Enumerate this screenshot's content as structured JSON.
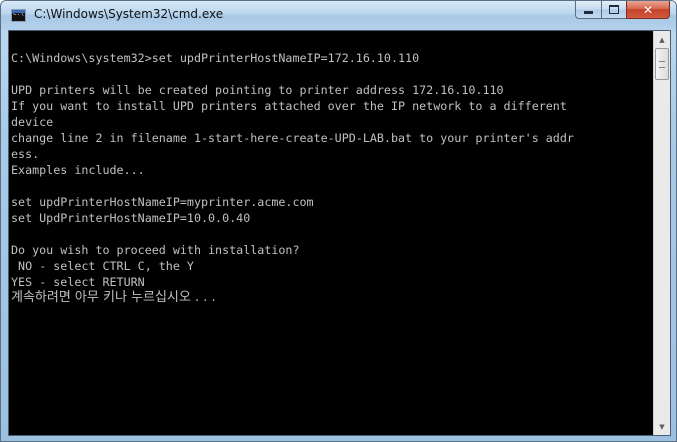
{
  "window": {
    "title": "C:\\Windows\\System32\\cmd.exe",
    "icon": "cmd-app-icon",
    "buttons": {
      "minimize": "minimize-icon",
      "maximize": "maximize-icon",
      "close": "close-icon"
    }
  },
  "console": {
    "lines": [
      "",
      "C:\\Windows\\system32>set updPrinterHostNameIP=172.16.10.110",
      "",
      "UPD printers will be created pointing to printer address 172.16.10.110",
      "If you want to install UPD printers attached over the IP network to a different",
      "device",
      "change line 2 in filename 1-start-here-create-UPD-LAB.bat to your printer's addr",
      "ess.",
      "Examples include...",
      "",
      "set updPrinterHostNameIP=myprinter.acme.com",
      "set UpdPrinterHostNameIP=10.0.0.40",
      "",
      "Do you wish to proceed with installation?",
      " NO - select CTRL C, the Y",
      "YES - select RETURN",
      "계속하려면 아무 키나 누르십시오 . . ."
    ],
    "text_color": "#c0c0c0",
    "background": "#000000"
  }
}
